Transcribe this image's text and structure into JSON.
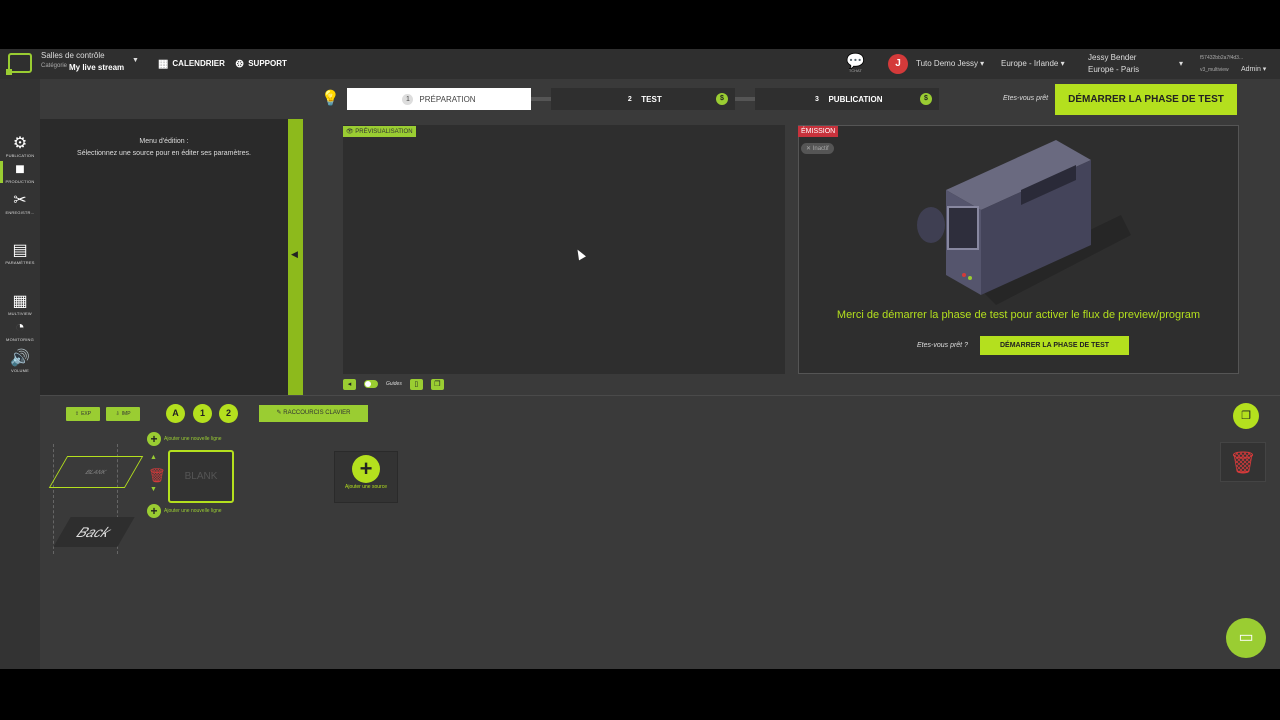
{
  "topbar": {
    "room_label": "Salles de contrôle",
    "room_sub": "Catégorie",
    "room_name": "My live stream",
    "calendar": "CALENDRIER",
    "support": "SUPPORT",
    "chat_label": "TCHAT",
    "avatar_initial": "J",
    "user_name": "Tuto Demo Jessy",
    "region": "Europe - Irlande",
    "account_name": "Jessy Bender",
    "account_zone": "Europe - Paris",
    "session_id": "f57432bb2a7f4d3...",
    "version": "v3_multiview",
    "role": "Admin"
  },
  "sidebar": {
    "items": [
      {
        "label": "PUBLICATION"
      },
      {
        "label": "PRODUCTION"
      },
      {
        "label": "ENREGISTR..."
      },
      {
        "label": "PARAMÈTRES"
      },
      {
        "label": "MULTIVIEW"
      },
      {
        "label": "MONITORING"
      },
      {
        "label": "VOLUME"
      }
    ]
  },
  "steps": [
    {
      "num": "1",
      "label": "PRÉPARATION"
    },
    {
      "num": "2",
      "label": "TEST",
      "badge": "$"
    },
    {
      "num": "3",
      "label": "PUBLICATION",
      "badge": "$"
    }
  ],
  "ready_text": "Etes-vous prêt",
  "start_button": "DÉMARRER LA PHASE DE TEST",
  "edit_panel": {
    "title": "Menu d'édition :",
    "desc": "Sélectionnez une source pour en éditer ses paramètres."
  },
  "preview": {
    "tag": "PRÉVISUALISATION",
    "guides": "Guides"
  },
  "emission": {
    "tag": "ÉMISSION",
    "chip": "Inactif",
    "message": "Merci de démarrer la phase de test pour activer le flux de preview/program",
    "ready": "Etes-vous prêt ?",
    "button": "DÉMARRER LA PHASE DE TEST"
  },
  "bottom": {
    "export": "EXP",
    "import": "IMP",
    "circles": [
      "A",
      "1",
      "2"
    ],
    "shortcuts": "RACCOURCIS CLAVIER",
    "add_line_top": "Ajouter une nouvelle ligne",
    "add_line_bottom": "Ajouter une nouvelle ligne",
    "scene_blank": "BLANK",
    "scene_back": "Back",
    "blank_card": "BLANK",
    "add_source": "Ajouter une source"
  },
  "colors": {
    "accent": "#b4e01e",
    "danger": "#d43a3a"
  }
}
